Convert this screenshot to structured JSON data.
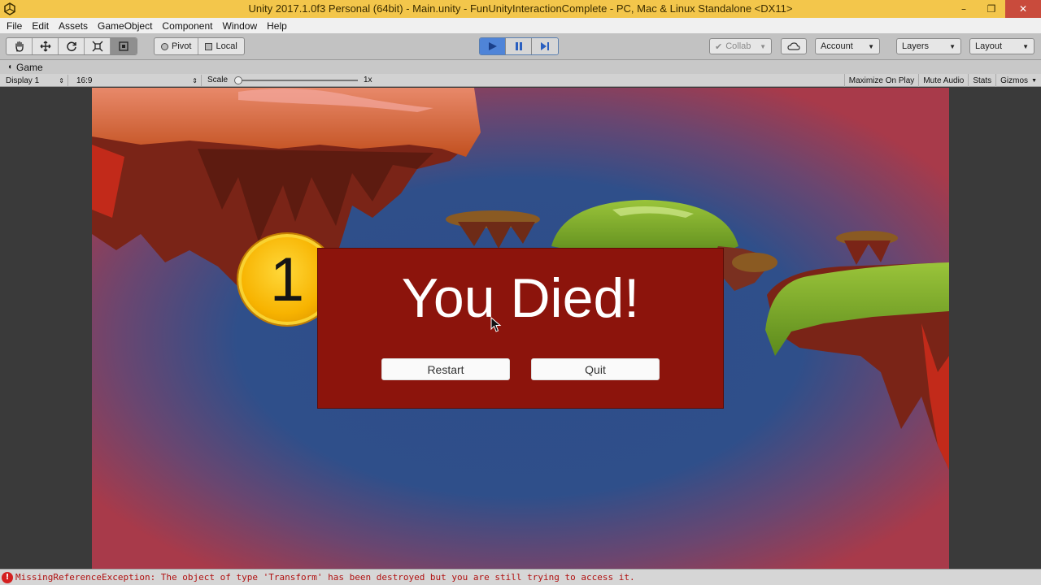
{
  "window": {
    "title": "Unity 2017.1.0f3 Personal (64bit) - Main.unity - FunUnityInteractionComplete - PC, Mac & Linux Standalone <DX11>",
    "minimize": "–",
    "maximize": "❐",
    "close": "✕"
  },
  "menu": [
    "File",
    "Edit",
    "Assets",
    "GameObject",
    "Component",
    "Window",
    "Help"
  ],
  "toolbar": {
    "pivot": "Pivot",
    "local": "Local",
    "collab": "Collab",
    "account": "Account",
    "layers": "Layers",
    "layout": "Layout"
  },
  "tab": {
    "label": "Game"
  },
  "gamebar": {
    "display": "Display 1",
    "aspect": "16:9",
    "scale_label": "Scale",
    "scale_value": "1x",
    "maximize": "Maximize On Play",
    "mute": "Mute Audio",
    "stats": "Stats",
    "gizmos": "Gizmos"
  },
  "game": {
    "coin_count": "1",
    "heading": "You Died!",
    "restart": "Restart",
    "quit": "Quit"
  },
  "status": {
    "message": "MissingReferenceException: The object of type 'Transform' has been destroyed but you are still trying to access it."
  },
  "colors": {
    "title_bar": "#f3c64b",
    "play_active": "#4f84d8",
    "panel": "#8c140c",
    "game_bg_edge": "#a53a4c",
    "game_bg_center": "#2f4f8a",
    "error": "#b01010"
  }
}
